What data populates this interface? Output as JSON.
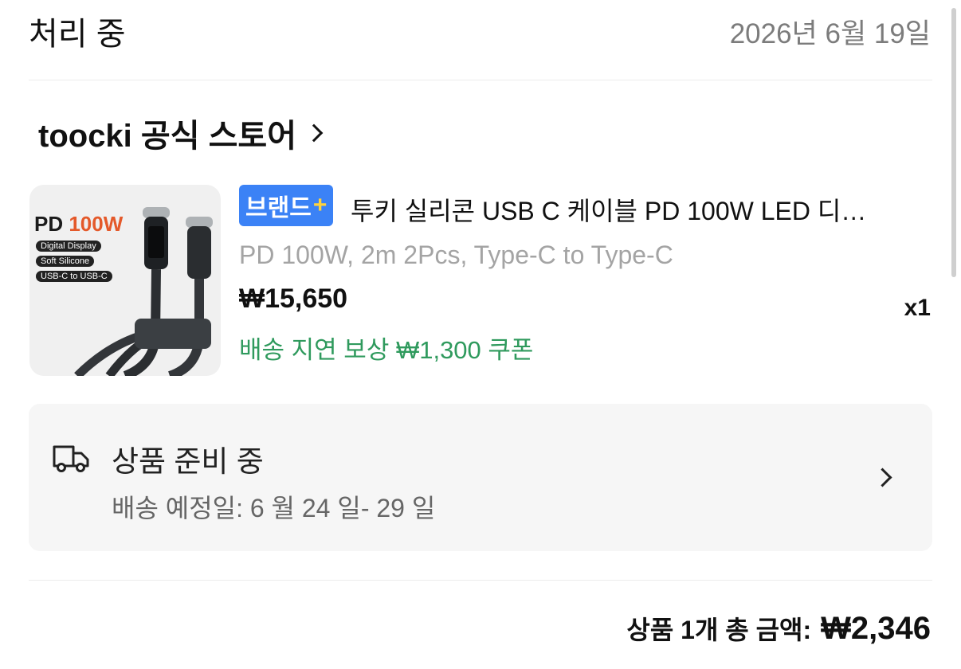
{
  "header": {
    "status": "처리 중",
    "date": "2026년 6월 19일"
  },
  "store": {
    "name": "toocki 공식 스토어"
  },
  "product": {
    "badge_label": "브랜드",
    "badge_plus": "+",
    "title": "투키 실리콘 USB C 케이블 PD 100W LED 디…",
    "option": "PD 100W, 2m 2Pcs, Type-C to Type-C",
    "price": "₩15,650",
    "quantity": "x1",
    "coupon": "배송 지연 보상 ₩1,300 쿠폰",
    "image_text": {
      "pd": "PD ",
      "watt": "100W",
      "tags": [
        "Digital Display",
        "Soft Silicone",
        "USB-C to USB-C"
      ]
    }
  },
  "shipping": {
    "status": "상품 준비 중",
    "eta": "배송 예정일: 6 월 24 일- 29 일"
  },
  "summary": {
    "label": "상품 1개 총 금액:",
    "amount": "₩2,346"
  },
  "colors": {
    "accent_blue": "#3b82f6",
    "badge_plus": "#ffd33d",
    "coupon_green": "#2f9a5d",
    "muted_gray": "#a4a4a4",
    "card_bg": "#f6f6f6"
  },
  "icons": {
    "store_chevron": "chevron-right-icon",
    "shipping": "truck-icon",
    "shipping_chevron": "chevron-right-icon"
  }
}
